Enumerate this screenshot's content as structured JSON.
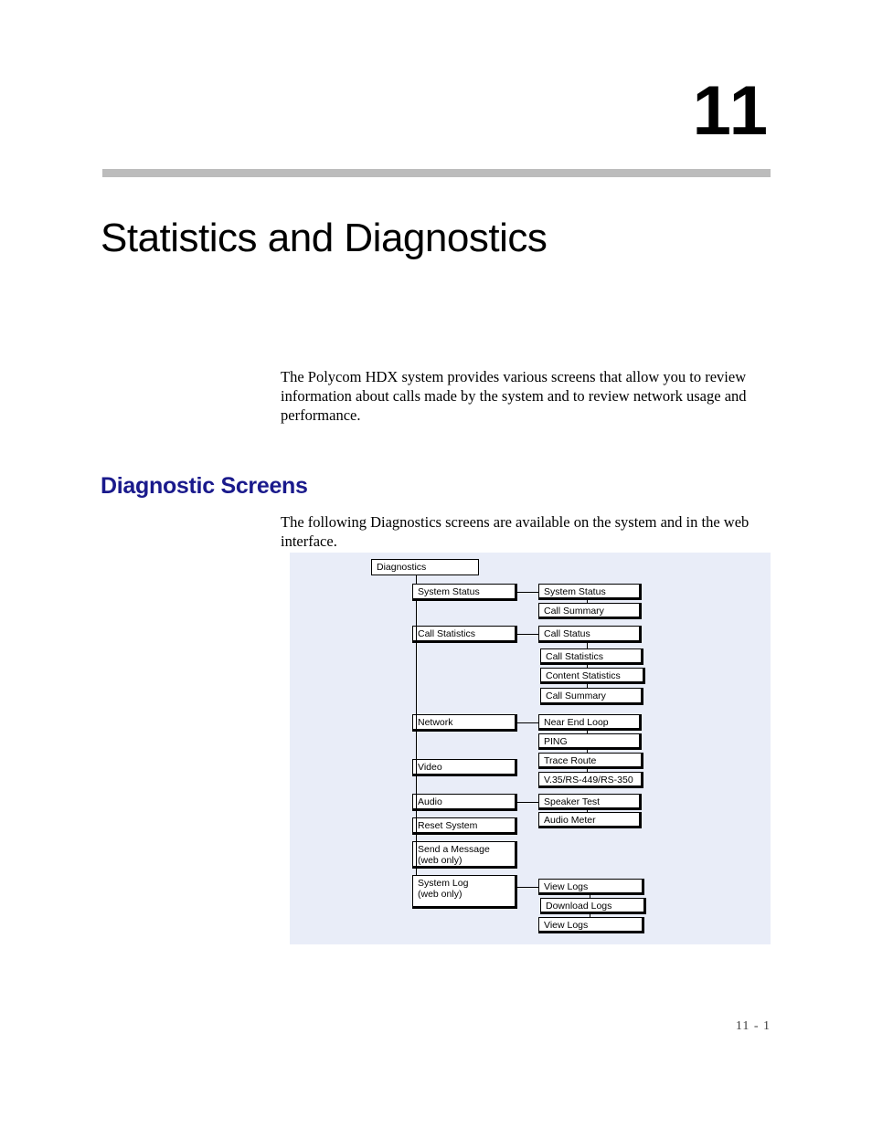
{
  "chapter": {
    "number": "11",
    "title": "Statistics and Diagnostics"
  },
  "intro_paragraph": "The Polycom HDX system provides various screens that allow you to review information about calls made by the system and to review network usage and performance.",
  "section": {
    "heading": "Diagnostic Screens",
    "paragraph": "The following Diagnostics screens are available on the system and in the web interface."
  },
  "diagram": {
    "root": {
      "label": "Diagnostics"
    },
    "level1": [
      {
        "label": "System Status"
      },
      {
        "label": "Call Statistics"
      },
      {
        "label": "Network"
      },
      {
        "label": "Video"
      },
      {
        "label": "Audio"
      },
      {
        "label": "Reset System"
      },
      {
        "label": "Send a Message\n(web only)"
      },
      {
        "label": "System Log\n(web only)"
      }
    ],
    "level2": [
      {
        "label": "System Status"
      },
      {
        "label": "Call Summary"
      },
      {
        "label": "Call Status"
      },
      {
        "label": "Call Statistics"
      },
      {
        "label": "Content Statistics"
      },
      {
        "label": "Call Summary"
      },
      {
        "label": "Near End Loop"
      },
      {
        "label": "PING"
      },
      {
        "label": "Trace Route"
      },
      {
        "label": "V.35/RS-449/RS-350"
      },
      {
        "label": "Speaker Test"
      },
      {
        "label": "Audio Meter"
      },
      {
        "label": "View Logs"
      },
      {
        "label": "Download Logs"
      },
      {
        "label": "View Logs"
      }
    ]
  },
  "footer": {
    "page_number": "11 - 1"
  },
  "colors": {
    "heading_blue": "#1a1a8c",
    "rule_gray": "#bcbcbc",
    "diagram_background": "#e9edf8"
  }
}
